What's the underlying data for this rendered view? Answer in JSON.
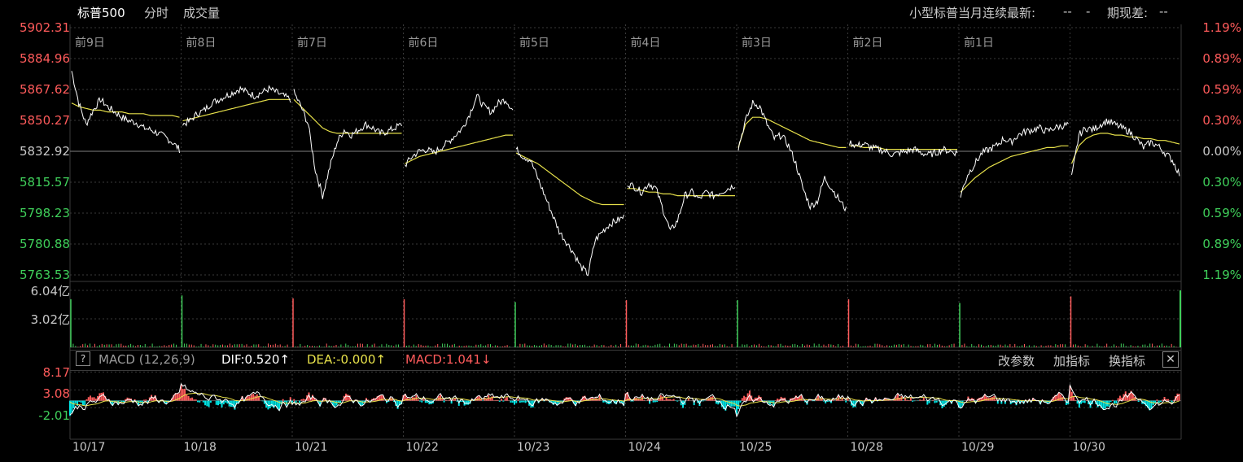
{
  "header": {
    "title": "标普500",
    "tab_timeshare": "分时",
    "tab_volume": "成交量",
    "contract_label": "小型标普当月连续最新:",
    "contract_value": "--",
    "contract_sep": "-",
    "basis_label": "期现差:",
    "basis_value": "--"
  },
  "price_axis": {
    "left": [
      "5902.31",
      "5884.96",
      "5867.62",
      "5850.27",
      "5832.92",
      "5815.57",
      "5798.23",
      "5780.88",
      "5763.53"
    ],
    "right": [
      "1.19%",
      "0.89%",
      "0.59%",
      "0.30%",
      "0.00%",
      "0.30%",
      "0.59%",
      "0.89%",
      "1.19%"
    ],
    "colors_left": [
      "#ff5b5b",
      "#ff5b5b",
      "#ff5b5b",
      "#ff5b5b",
      "#c8c8c8",
      "#3fcf5a",
      "#3fcf5a",
      "#3fcf5a",
      "#3fcf5a"
    ],
    "colors_right": [
      "#ff5b5b",
      "#ff5b5b",
      "#ff5b5b",
      "#ff5b5b",
      "#c8c8c8",
      "#3fcf5a",
      "#3fcf5a",
      "#3fcf5a",
      "#3fcf5a"
    ]
  },
  "day_labels": [
    "前9日",
    "前8日",
    "前7日",
    "前6日",
    "前5日",
    "前4日",
    "前3日",
    "前2日",
    "前1日"
  ],
  "volume_axis": {
    "top": "6.04亿",
    "mid": "3.02亿"
  },
  "macd": {
    "help": "?",
    "name": "MACD (12,26,9)",
    "dif": "DIF:0.520↑",
    "dea": "DEA:-0.000↑",
    "macd": "MACD:1.041↓",
    "btn_params": "改参数",
    "btn_add": "加指标",
    "btn_switch": "换指标",
    "btn_close": "✕",
    "axis": [
      "8.17",
      "3.08",
      "-2.01"
    ]
  },
  "x_dates": [
    "10/17",
    "10/18",
    "10/21",
    "10/22",
    "10/23",
    "10/24",
    "10/25",
    "10/28",
    "10/29",
    "10/30"
  ],
  "colors": {
    "up": "#ff5b5b",
    "down": "#3fcf5a",
    "price_line": "#ffffff",
    "avg_line": "#e6e04a",
    "macd_dea": "#e6e04a",
    "macd_neg": "#00e5e5",
    "grid": "#3a3a3a"
  },
  "chart_data": {
    "type": "line",
    "title": "标普500",
    "base": 5832.92,
    "ylim": [
      5763.53,
      5902.31
    ],
    "x": [
      "10/17",
      "10/18",
      "10/21",
      "10/22",
      "10/23",
      "10/24",
      "10/25",
      "10/28",
      "10/29",
      "10/30"
    ],
    "series": [
      {
        "name": "price",
        "days": [
          [
            5878,
            5860,
            5848,
            5856,
            5862,
            5858,
            5855,
            5852,
            5850,
            5849,
            5846,
            5845,
            5843,
            5841,
            5838,
            5834
          ],
          [
            5848,
            5850,
            5854,
            5856,
            5860,
            5862,
            5864,
            5866,
            5868,
            5866,
            5864,
            5866,
            5868,
            5866,
            5864,
            5862
          ],
          [
            5866,
            5858,
            5848,
            5822,
            5808,
            5824,
            5838,
            5845,
            5842,
            5845,
            5848,
            5846,
            5843,
            5844,
            5846,
            5848
          ],
          [
            5825,
            5830,
            5833,
            5834,
            5832,
            5835,
            5838,
            5842,
            5846,
            5854,
            5864,
            5858,
            5855,
            5860,
            5862,
            5856
          ],
          [
            5834,
            5830,
            5828,
            5818,
            5808,
            5798,
            5788,
            5782,
            5776,
            5768,
            5764,
            5783,
            5788,
            5792,
            5794,
            5796
          ],
          [
            5815,
            5813,
            5810,
            5815,
            5812,
            5800,
            5788,
            5794,
            5808,
            5810,
            5806,
            5810,
            5808,
            5810,
            5812,
            5814
          ],
          [
            5835,
            5850,
            5860,
            5858,
            5848,
            5840,
            5842,
            5836,
            5826,
            5812,
            5802,
            5805,
            5818,
            5812,
            5806,
            5800
          ],
          [
            5838,
            5836,
            5837,
            5835,
            5834,
            5833,
            5831,
            5832,
            5833,
            5834,
            5832,
            5831,
            5832,
            5834,
            5833,
            5832
          ],
          [
            5808,
            5820,
            5826,
            5832,
            5834,
            5836,
            5840,
            5838,
            5842,
            5844,
            5845,
            5846,
            5844,
            5846,
            5847,
            5848
          ],
          [
            5818,
            5842,
            5846,
            5845,
            5848,
            5850,
            5848,
            5846,
            5844,
            5840,
            5835,
            5838,
            5836,
            5832,
            5828,
            5820
          ]
        ]
      },
      {
        "name": "avg",
        "days": [
          [
            5860,
            5858,
            5857,
            5856,
            5856,
            5855,
            5855,
            5855,
            5854,
            5854,
            5854,
            5853,
            5853,
            5853,
            5853,
            5852
          ],
          [
            5850,
            5851,
            5852,
            5853,
            5854,
            5855,
            5856,
            5857,
            5858,
            5859,
            5860,
            5861,
            5862,
            5862,
            5862,
            5862
          ],
          [
            5862,
            5858,
            5854,
            5850,
            5846,
            5844,
            5843,
            5843,
            5843,
            5843,
            5843,
            5843,
            5843,
            5843,
            5843,
            5843
          ],
          [
            5826,
            5828,
            5830,
            5831,
            5832,
            5833,
            5834,
            5835,
            5836,
            5837,
            5838,
            5839,
            5840,
            5841,
            5842,
            5842
          ],
          [
            5832,
            5830,
            5828,
            5826,
            5823,
            5820,
            5817,
            5814,
            5811,
            5808,
            5806,
            5804,
            5803,
            5803,
            5803,
            5803
          ],
          [
            5812,
            5812,
            5811,
            5810,
            5810,
            5809,
            5809,
            5808,
            5808,
            5808,
            5808,
            5808,
            5808,
            5808,
            5808,
            5808
          ],
          [
            5835,
            5848,
            5852,
            5852,
            5851,
            5849,
            5847,
            5845,
            5843,
            5841,
            5839,
            5838,
            5837,
            5836,
            5835,
            5835
          ],
          [
            5836,
            5836,
            5835,
            5835,
            5835,
            5834,
            5834,
            5834,
            5834,
            5834,
            5834,
            5834,
            5834,
            5834,
            5834,
            5834
          ],
          [
            5810,
            5814,
            5818,
            5821,
            5824,
            5826,
            5828,
            5830,
            5831,
            5832,
            5833,
            5834,
            5835,
            5835,
            5836,
            5836
          ],
          [
            5826,
            5836,
            5840,
            5842,
            5843,
            5843,
            5842,
            5842,
            5841,
            5841,
            5840,
            5840,
            5839,
            5839,
            5838,
            5837
          ]
        ]
      }
    ],
    "volume": {
      "unit": "亿",
      "ylim": [
        0,
        6.04
      ],
      "open_spikes": [
        5.1,
        5.5,
        5.2,
        5.1,
        4.8,
        5.0,
        5.0,
        5.1,
        4.7,
        5.4
      ],
      "open_colors": [
        "down",
        "down",
        "up",
        "up",
        "down",
        "up",
        "down",
        "up",
        "down",
        "up"
      ],
      "last_spike": 6.04,
      "last_color": "down"
    },
    "macd": {
      "ylim": [
        -4.5,
        8.5
      ],
      "dif_last": 0.52,
      "dea_last": -0.0,
      "macd_last": 1.041
    }
  }
}
